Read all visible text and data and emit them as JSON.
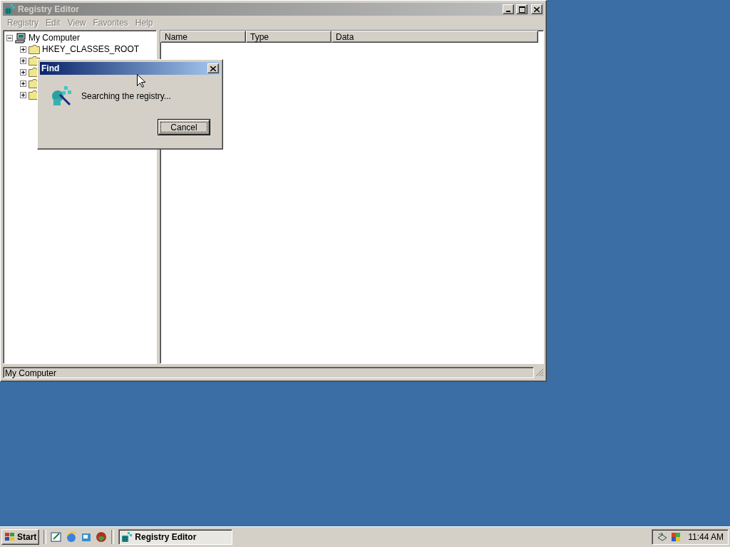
{
  "window": {
    "title": "Registry Editor",
    "active": false
  },
  "menu": [
    {
      "label": "Registry",
      "disabled": true
    },
    {
      "label": "Edit",
      "disabled": true
    },
    {
      "label": "View",
      "disabled": true
    },
    {
      "label": "Favorites",
      "disabled": true
    },
    {
      "label": "Help",
      "disabled": true
    }
  ],
  "tree": [
    {
      "label": "My Computer",
      "expanded": true,
      "children": [
        {
          "label": "HKEY_CLASSES_ROOT",
          "expanded": false
        },
        {
          "expanded": false
        },
        {
          "expanded": false
        },
        {
          "expanded": false
        },
        {
          "expanded": false
        }
      ]
    }
  ],
  "list": {
    "columns": [
      "Name",
      "Type",
      "Data"
    ]
  },
  "status_bar": "My Computer",
  "dialog": {
    "title": "Find",
    "active": true,
    "message": "Searching the registry...",
    "button": "Cancel"
  },
  "taskbar": {
    "start": "Start",
    "tasks": [
      {
        "label": "Registry Editor",
        "selected": true
      }
    ],
    "clock": "11:44 AM"
  }
}
